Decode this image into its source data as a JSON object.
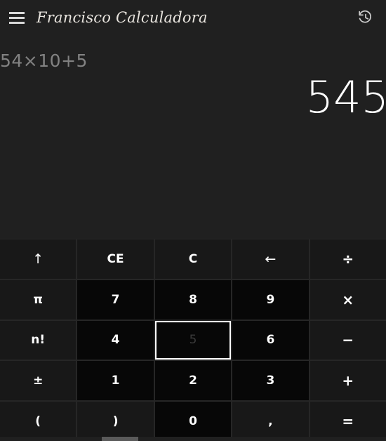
{
  "window": {
    "title": "Francisco Calculadora"
  },
  "titlebar": {
    "menu_icon": "hamburger-menu-icon",
    "history_icon": "history-icon"
  },
  "display": {
    "expression": "54×10+5",
    "result": "545"
  },
  "keypad": {
    "keys": [
      {
        "label": "↑",
        "name": "key-shift-up",
        "style": "func",
        "row": 1,
        "col": 1
      },
      {
        "label": "CE",
        "name": "key-clear-entry",
        "style": "func",
        "row": 1,
        "col": 2
      },
      {
        "label": "C",
        "name": "key-clear",
        "style": "func",
        "row": 1,
        "col": 3
      },
      {
        "label": "←",
        "name": "key-backspace",
        "style": "func",
        "row": 1,
        "col": 4
      },
      {
        "label": "÷",
        "name": "key-divide",
        "style": "op",
        "row": 1,
        "col": 5
      },
      {
        "label": "π",
        "name": "key-pi",
        "style": "func",
        "row": 2,
        "col": 1
      },
      {
        "label": "7",
        "name": "key-7",
        "style": "num",
        "row": 2,
        "col": 2
      },
      {
        "label": "8",
        "name": "key-8",
        "style": "num",
        "row": 2,
        "col": 3
      },
      {
        "label": "9",
        "name": "key-9",
        "style": "num",
        "row": 2,
        "col": 4
      },
      {
        "label": "×",
        "name": "key-multiply",
        "style": "op",
        "row": 2,
        "col": 5
      },
      {
        "label": "n!",
        "name": "key-factorial",
        "style": "func",
        "row": 3,
        "col": 1
      },
      {
        "label": "4",
        "name": "key-4",
        "style": "num",
        "row": 3,
        "col": 2
      },
      {
        "label": "5",
        "name": "key-5",
        "style": "num",
        "row": 3,
        "col": 3,
        "focused": true
      },
      {
        "label": "6",
        "name": "key-6",
        "style": "num",
        "row": 3,
        "col": 4
      },
      {
        "label": "−",
        "name": "key-subtract",
        "style": "op",
        "row": 3,
        "col": 5
      },
      {
        "label": "±",
        "name": "key-plus-minus",
        "style": "func",
        "row": 4,
        "col": 1
      },
      {
        "label": "1",
        "name": "key-1",
        "style": "num",
        "row": 4,
        "col": 2
      },
      {
        "label": "2",
        "name": "key-2",
        "style": "num",
        "row": 4,
        "col": 3
      },
      {
        "label": "3",
        "name": "key-3",
        "style": "num",
        "row": 4,
        "col": 4
      },
      {
        "label": "+",
        "name": "key-add",
        "style": "op",
        "row": 4,
        "col": 5
      },
      {
        "label": "(",
        "name": "key-paren-open",
        "style": "func",
        "row": 5,
        "col": 1
      },
      {
        "label": ")",
        "name": "key-paren-close",
        "style": "func",
        "row": 5,
        "col": 2
      },
      {
        "label": "0",
        "name": "key-0",
        "style": "num",
        "row": 5,
        "col": 3
      },
      {
        "label": ",",
        "name": "key-decimal-comma",
        "style": "func",
        "row": 5,
        "col": 4
      },
      {
        "label": "=",
        "name": "key-equals",
        "style": "op",
        "row": 5,
        "col": 5
      }
    ]
  },
  "colors": {
    "background": "#202020",
    "function_key": "#181818",
    "number_key": "#070707",
    "text": "#ffffff",
    "expression_text": "#828282",
    "focus_outline": "#ffffff"
  }
}
